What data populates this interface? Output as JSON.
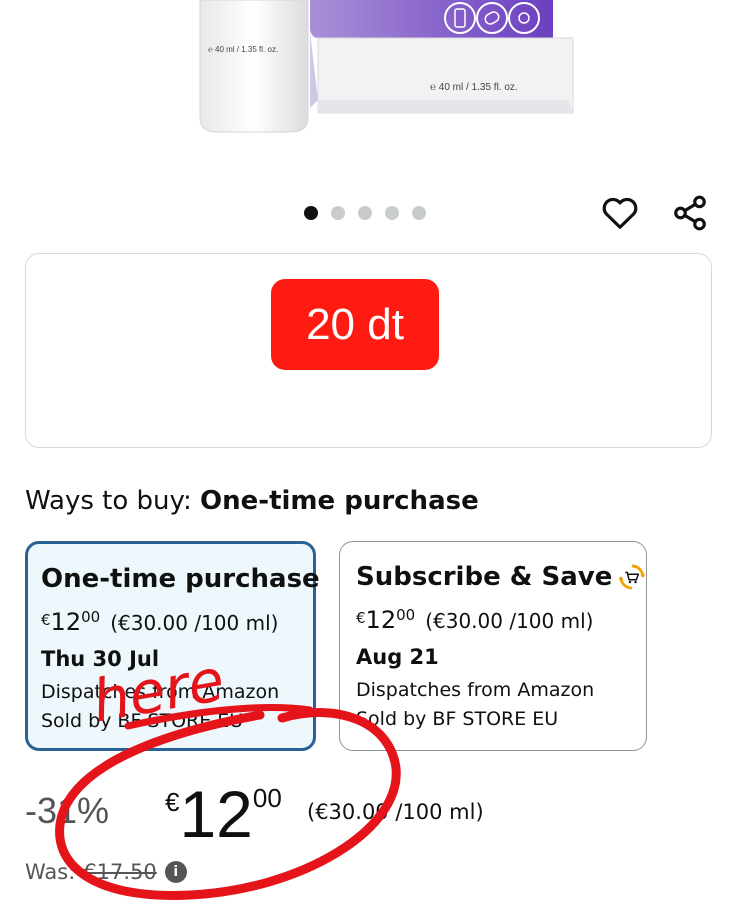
{
  "product": {
    "tube_label": "℮ 40 ml / 1.35 fl. oz.",
    "box_label": "℮ 40 ml / 1.35 fl. oz."
  },
  "carousel": {
    "count": 5,
    "active_index": 0
  },
  "sticker": {
    "text": "20 dt"
  },
  "ways_to_buy": {
    "prefix": "Ways to buy:",
    "selected": "One-time purchase"
  },
  "options": [
    {
      "title": "One-time purchase",
      "price_symbol": "€",
      "price_whole": "12",
      "price_fraction": "00",
      "unit_price": "(€30.00 /100 ml)",
      "date": "Thu 30 Jul",
      "dispatch": "Dispatches from Amazon",
      "seller": "Sold by BF STORE EU"
    },
    {
      "title": "Subscribe & Save",
      "price_symbol": "€",
      "price_whole": "12",
      "price_fraction": "00",
      "unit_price": "(€30.00 /100 ml)",
      "date": "Aug 21",
      "dispatch": "Dispatches from Amazon",
      "seller": "Sold by BF STORE EU"
    }
  ],
  "price": {
    "discount": "-31%",
    "symbol": "€",
    "whole": "12",
    "fraction": "00",
    "unit_price": "(€30.00 /100 ml)",
    "was_label": "Was:",
    "was_price": "€17.50"
  },
  "annotation": {
    "text": "here",
    "color": "#e5141b"
  },
  "icons": [
    "heart-icon",
    "share-icon",
    "subscribe-cart-icon",
    "info-icon"
  ]
}
